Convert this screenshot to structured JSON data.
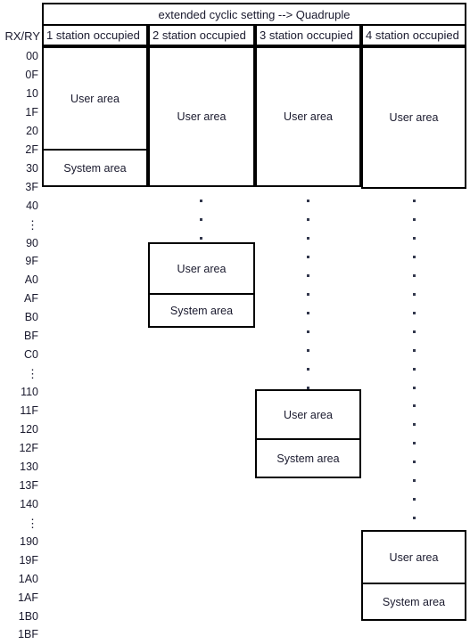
{
  "header": {
    "title": "extended cyclic setting --> Quadruple",
    "row_axis_label": "RX/RY",
    "columns": [
      {
        "label": "1 station occupied"
      },
      {
        "label": "2 station occupied"
      },
      {
        "label": "3 station occupied"
      },
      {
        "label": "4 station occupied"
      }
    ]
  },
  "labels": {
    "user_area": "User area",
    "system_area": "System area",
    "ellipsis": "⋮"
  },
  "addresses": [
    "00",
    "0F",
    "10",
    "1F",
    "20",
    "2F",
    "30",
    "3F",
    "40",
    "⋮",
    "90",
    "9F",
    "A0",
    "AF",
    "B0",
    "BF",
    "C0",
    "⋮",
    "110",
    "11F",
    "120",
    "12F",
    "130",
    "13F",
    "140",
    "⋮",
    "190",
    "19F",
    "1A0",
    "1AF",
    "1B0",
    "1BF"
  ],
  "chart_data": {
    "type": "table",
    "title": "extended cyclic setting --> Quadruple",
    "ylabel": "RX/RY",
    "columns": [
      "1 station occupied",
      "2 station occupied",
      "3 station occupied",
      "4 station occupied"
    ],
    "row_labels": [
      "00",
      "0F",
      "10",
      "1F",
      "20",
      "2F",
      "30",
      "3F",
      "40",
      "⋮",
      "90",
      "9F",
      "A0",
      "AF",
      "B0",
      "BF",
      "C0",
      "⋮",
      "110",
      "11F",
      "120",
      "12F",
      "130",
      "13F",
      "140",
      "⋮",
      "190",
      "19F",
      "1A0",
      "1AF",
      "1B0",
      "1BF"
    ],
    "blocks": [
      {
        "column": 1,
        "type": "User area",
        "start": "00",
        "end": "2F"
      },
      {
        "column": 1,
        "type": "System area",
        "start": "30",
        "end": "3F"
      },
      {
        "column": 2,
        "type": "User area",
        "start": "00",
        "end": "9F"
      },
      {
        "column": 2,
        "type": "System area",
        "start": "B0",
        "end": "BF"
      },
      {
        "column": 3,
        "type": "User area",
        "start": "00",
        "end": "11F"
      },
      {
        "column": 3,
        "type": "System area",
        "start": "130",
        "end": "13F"
      },
      {
        "column": 4,
        "type": "User area",
        "start": "00",
        "end": "19F"
      },
      {
        "column": 4,
        "type": "System area",
        "start": "1B0",
        "end": "1BF"
      }
    ]
  },
  "areas": {
    "col1_user": "User area",
    "col1_system": "System area",
    "col2_user_top": "User area",
    "col2_user_bottom": "User area",
    "col2_system": "System area",
    "col3_user_top": "User area",
    "col3_user_bottom": "User area",
    "col3_system": "System area",
    "col4_user_top": "User area",
    "col4_user_bottom": "User area",
    "col4_system": "System area"
  }
}
